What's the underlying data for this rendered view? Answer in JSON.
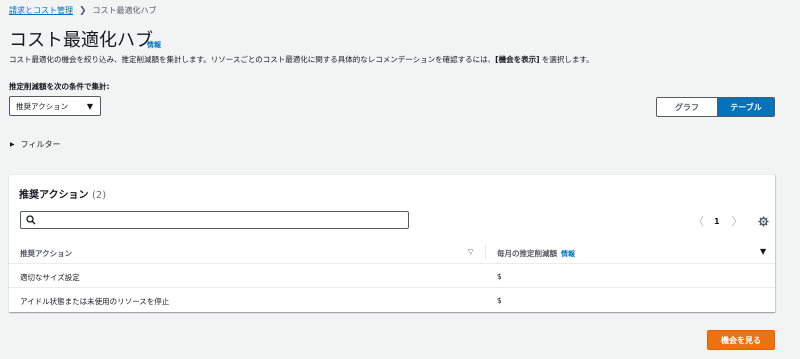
{
  "breadcrumb": {
    "parent": "請求とコスト管理",
    "separator": "❯",
    "current": "コスト最適化ハブ"
  },
  "header": {
    "title": "コスト最適化ハブ",
    "info_link": "情報",
    "description_pre": "コスト最適化の機会を絞り込み、推定削減額を集計します。リソースごとのコスト最適化に関する具体的なレコメンデーションを確認するには、",
    "description_bold": "[機会を表示]",
    "description_post": " を選択します。"
  },
  "aggregation": {
    "label": "推定削減額を次の条件で集計:",
    "selected": "推奨アクション",
    "caret": "▼"
  },
  "view_toggle": {
    "graph_label": "グラフ",
    "table_label": "テーブル",
    "active": "table"
  },
  "filter": {
    "label": "フィルター",
    "triangle": "▶"
  },
  "panel": {
    "title": "推奨アクション",
    "count": "(2)",
    "search": {
      "placeholder": "",
      "value": ""
    },
    "pager": {
      "prev": "〈",
      "page": "1",
      "next": "〉"
    },
    "columns": [
      {
        "label": "推奨アクション",
        "sort_icon": "▽"
      },
      {
        "label": "毎月の推定削減額",
        "info": "情報",
        "sort_icon": "▼"
      }
    ],
    "rows": [
      {
        "action": "適切なサイズ設定",
        "savings": "$"
      },
      {
        "action": "アイドル状態または未使用のリソースを停止",
        "savings": "$"
      }
    ]
  },
  "actions": {
    "view_opportunities": "機会を見る"
  },
  "colors": {
    "link": "#0073bb",
    "primary": "#ec7211",
    "toggle_active": "#0073bb",
    "background": "#f2f3f3"
  },
  "icons": {
    "search": "search-icon",
    "settings": "gear-icon"
  }
}
